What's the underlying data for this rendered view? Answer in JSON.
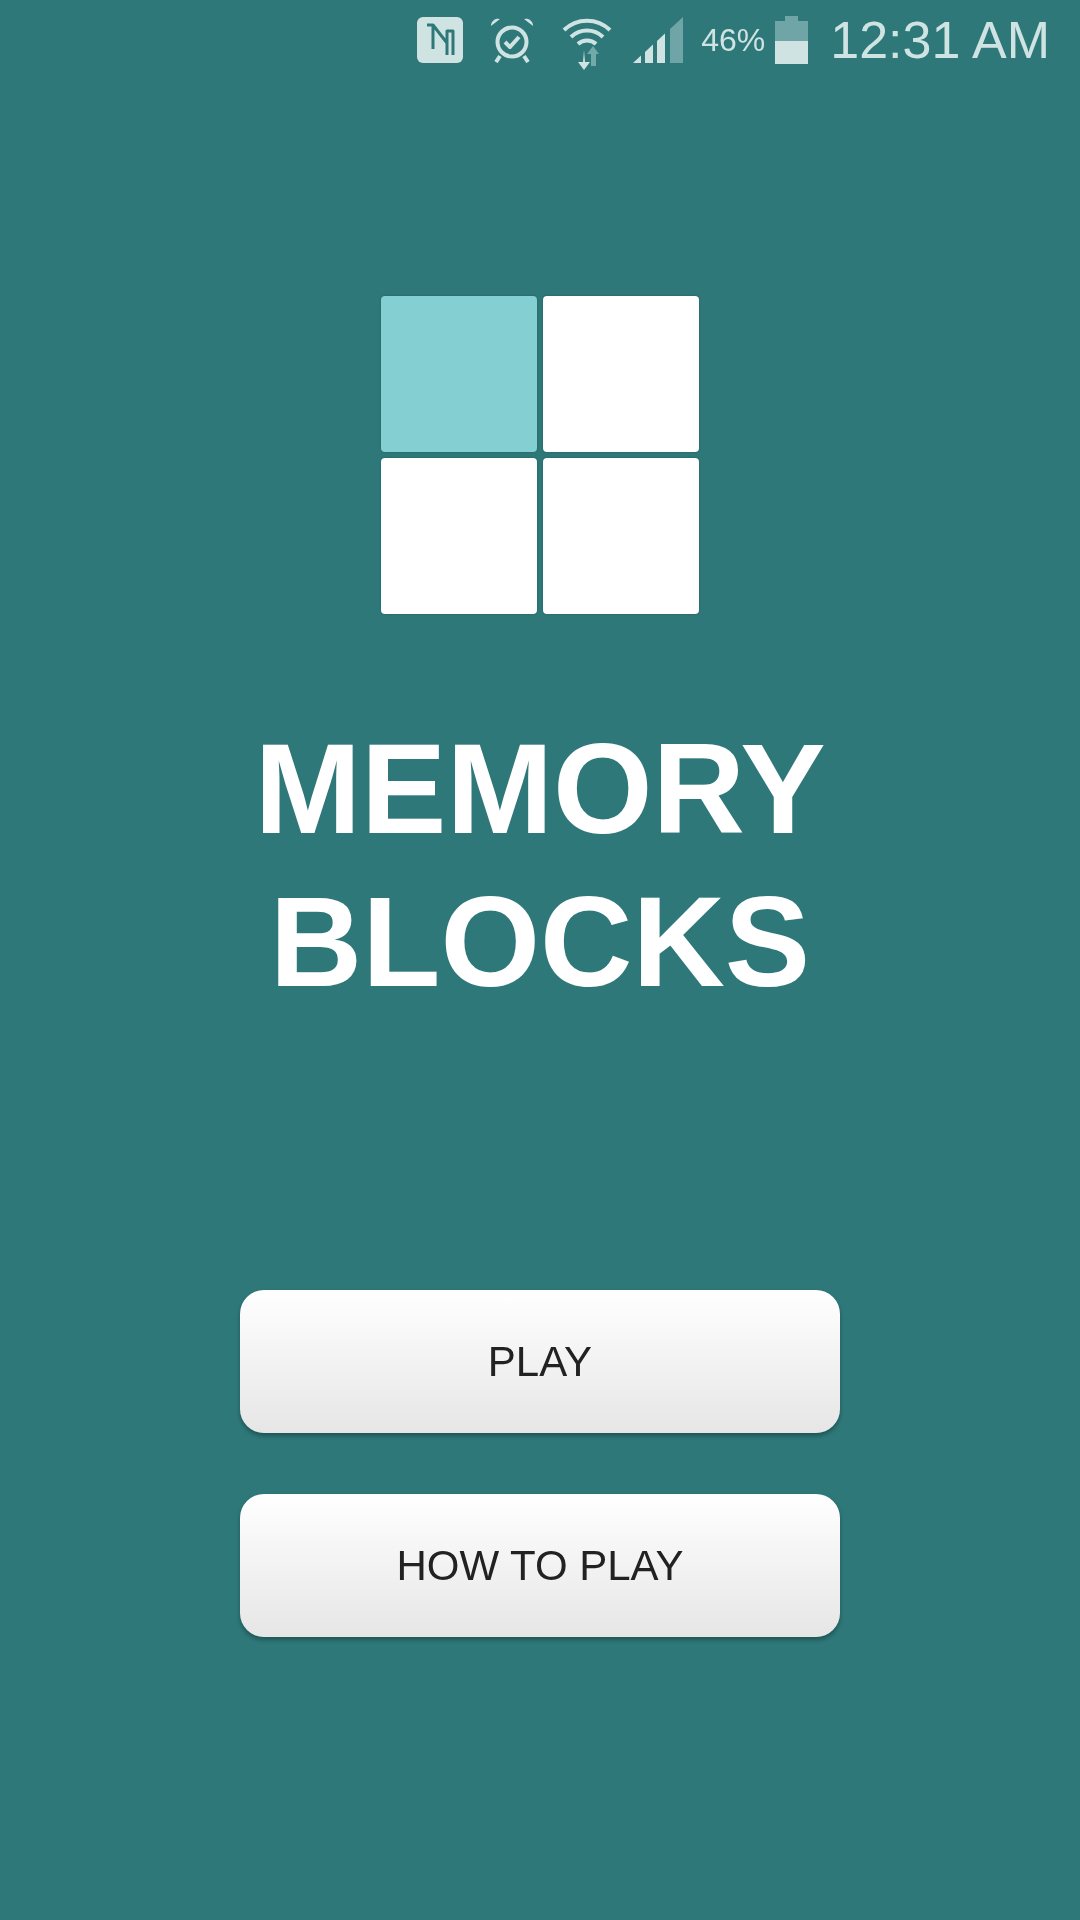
{
  "status_bar": {
    "battery_text": "46%",
    "time": "12:31 AM"
  },
  "logo": {
    "tiles": [
      {
        "lit": true
      },
      {
        "lit": false
      },
      {
        "lit": false
      },
      {
        "lit": false
      }
    ]
  },
  "title": "MEMORY BLOCKS",
  "buttons": [
    {
      "label": "PLAY"
    },
    {
      "label": "HOW TO PLAY"
    }
  ]
}
